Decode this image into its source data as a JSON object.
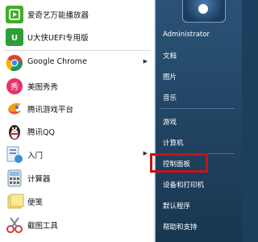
{
  "left_menu": {
    "items": [
      {
        "label": "爱奇艺万能播放器",
        "icon": "iqiyi-player-icon"
      },
      {
        "label": "U大侠UEFI专用版",
        "icon": "udaxia-uefi-icon"
      },
      {
        "label": "Google Chrome",
        "icon": "chrome-icon",
        "submenu": "▶"
      },
      {
        "label": "美图秀秀",
        "icon": "meitu-icon"
      },
      {
        "label": "腾讯游戏平台",
        "icon": "tencent-games-icon"
      },
      {
        "label": "腾讯QQ",
        "icon": "qq-penguin-icon"
      },
      {
        "label": "入门",
        "icon": "getting-started-icon",
        "submenu": "▶"
      },
      {
        "label": "计算器",
        "icon": "calculator-icon"
      },
      {
        "label": "便笺",
        "icon": "sticky-notes-icon"
      },
      {
        "label": "截图工具",
        "icon": "snipping-tool-icon"
      }
    ]
  },
  "right_menu": {
    "user": "Administrator",
    "items": [
      "文档",
      "图片",
      "音乐",
      "游戏",
      "计算机",
      "控制面板",
      "设备和打印机",
      "默认程序",
      "帮助和支持"
    ]
  },
  "highlight_color": "#c4141a"
}
